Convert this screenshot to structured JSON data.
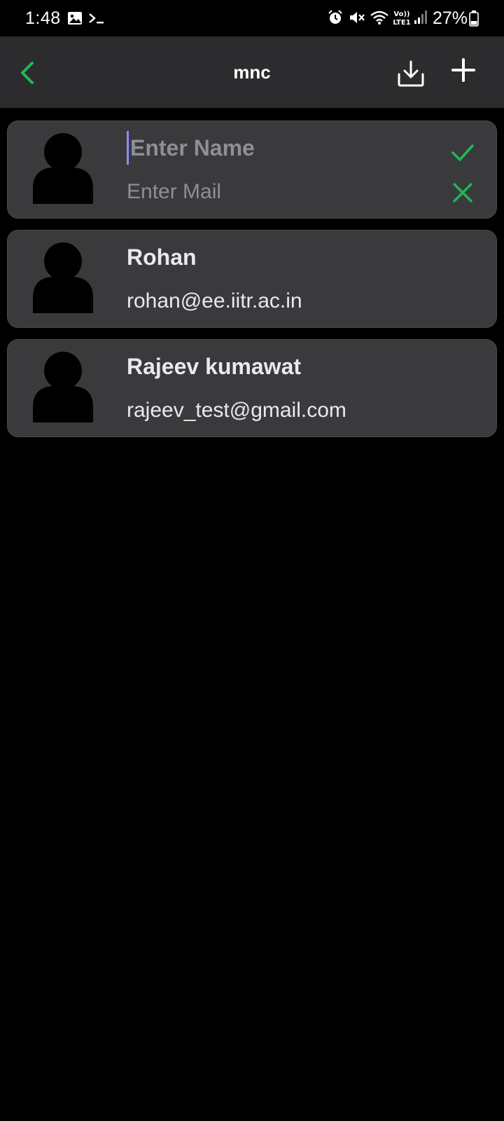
{
  "status_bar": {
    "time": "1:48",
    "battery": "27%",
    "icons": [
      "gallery-icon",
      "terminal-icon",
      "alarm-icon",
      "mute-icon",
      "wifi-icon",
      "volte-lte-icon",
      "signal-icon",
      "battery-icon"
    ],
    "volte_text": "Vo)) LTE1"
  },
  "app_bar": {
    "title": "mnc",
    "accent_color": "#1db954"
  },
  "new_contact": {
    "name_placeholder": "Enter Name",
    "mail_placeholder": "Enter Mail",
    "name_value": "",
    "mail_value": ""
  },
  "contacts": [
    {
      "name": "Rohan",
      "email": "rohan@ee.iitr.ac.in"
    },
    {
      "name": "Rajeev kumawat",
      "email": "rajeev_test@gmail.com"
    }
  ],
  "colors": {
    "background": "#000000",
    "app_bar": "#2c2c2e",
    "card": "#3a3a3c",
    "accent_green": "#1db954",
    "text": "#e9e9ee",
    "placeholder": "#8e8e93"
  }
}
